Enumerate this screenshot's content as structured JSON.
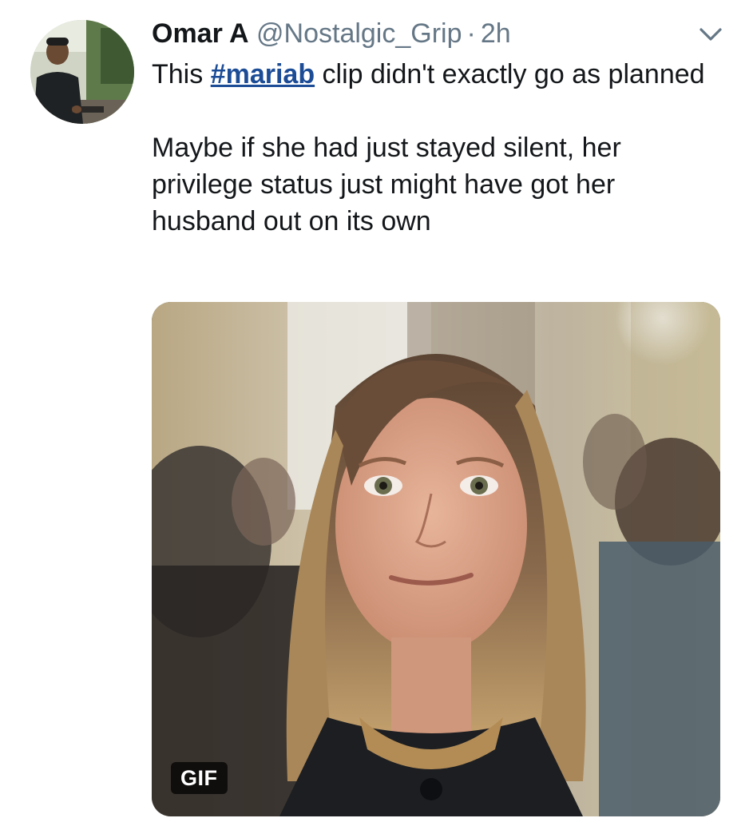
{
  "tweet": {
    "author": {
      "display_name": "Omar A",
      "handle": "@Nostalgic_Grip",
      "avatar_icon": "user-avatar-photo"
    },
    "separator": "·",
    "time": "2h",
    "menu_icon": "chevron-down-icon",
    "text": {
      "line1_prefix": "This ",
      "hashtag": "#mariab",
      "line1_suffix": " clip didn't exactly go as planned",
      "paragraph2": "Maybe if she had just stayed silent, her privilege status just might have got her husband out on its own"
    },
    "media": {
      "type": "gif",
      "badge": "GIF"
    },
    "colors": {
      "text": "#14171a",
      "secondary": "#657786",
      "hashtag": "#1c4c96"
    }
  }
}
